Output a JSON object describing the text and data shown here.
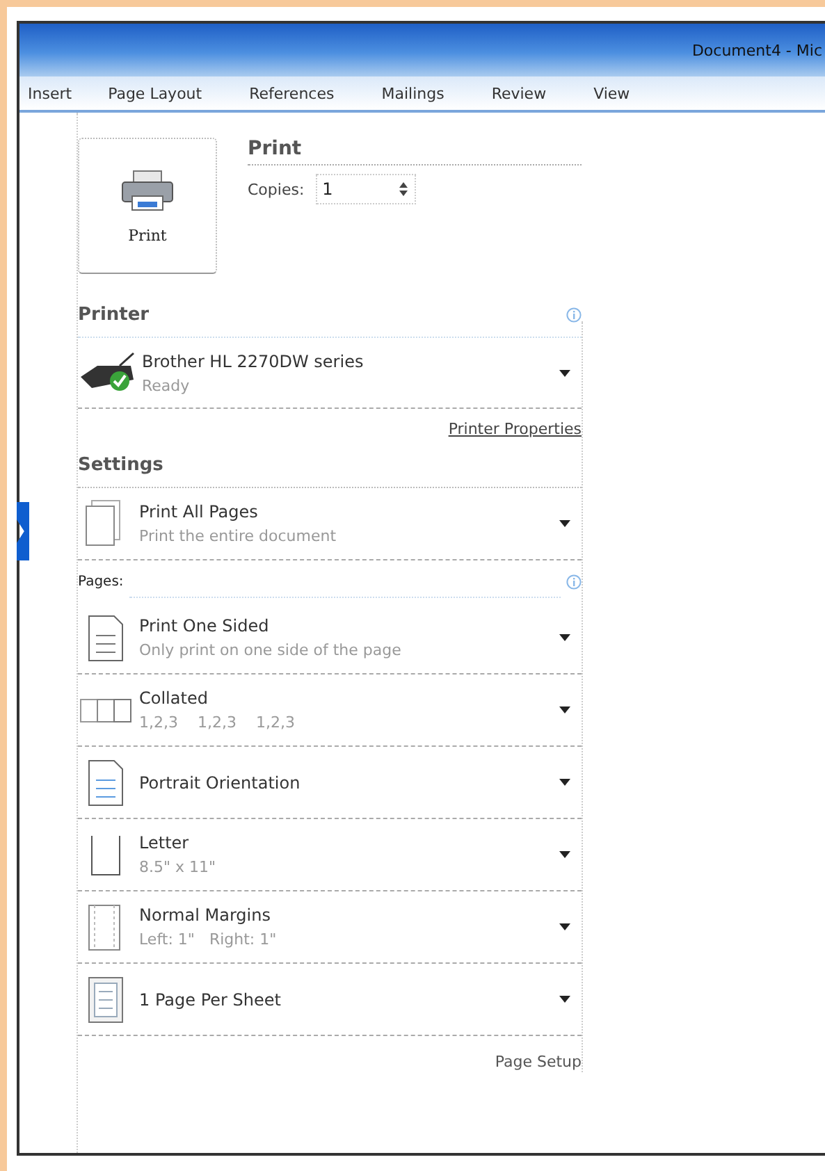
{
  "window": {
    "title": "Document4 - Mic"
  },
  "tabs": [
    {
      "label": "Insert",
      "selected": false
    },
    {
      "label": "Page Layout",
      "selected": false
    },
    {
      "label": "References",
      "selected": false
    },
    {
      "label": "Mailings",
      "selected": false
    },
    {
      "label": "Review",
      "selected": false
    },
    {
      "label": "View",
      "selected": false
    }
  ],
  "print": {
    "button": "Print",
    "heading": "Print",
    "copies_label": "Copies:",
    "copies_value": "1"
  },
  "printer": {
    "heading": "Printer",
    "name": "Brother HL 2270DW series",
    "status": "Ready",
    "properties_link": "Printer Properties"
  },
  "settings": {
    "heading": "Settings",
    "items": [
      {
        "kind": "dropdown",
        "title": "Print All Pages",
        "subtitle": "Print the entire document"
      },
      {
        "kind": "field",
        "label": "Pages:"
      },
      {
        "kind": "dropdown",
        "title": "Print One Sided",
        "subtitle": "Only print on one side of the page"
      },
      {
        "kind": "dropdown",
        "title": "Collated",
        "subtitle": "1,2,3    1,2,3    1,2,3"
      },
      {
        "kind": "dropdown",
        "title": "Portrait Orientation"
      },
      {
        "kind": "dropdown",
        "title": "Letter",
        "subtitle": "8.5\" x 11\""
      },
      {
        "kind": "dropdown",
        "title": "Normal Margins",
        "subtitle": "Left: 1\"   Right: 1\""
      },
      {
        "kind": "dropdown",
        "title": "1 Page Per Sheet"
      }
    ],
    "page_setup_link": "Page Setup"
  }
}
